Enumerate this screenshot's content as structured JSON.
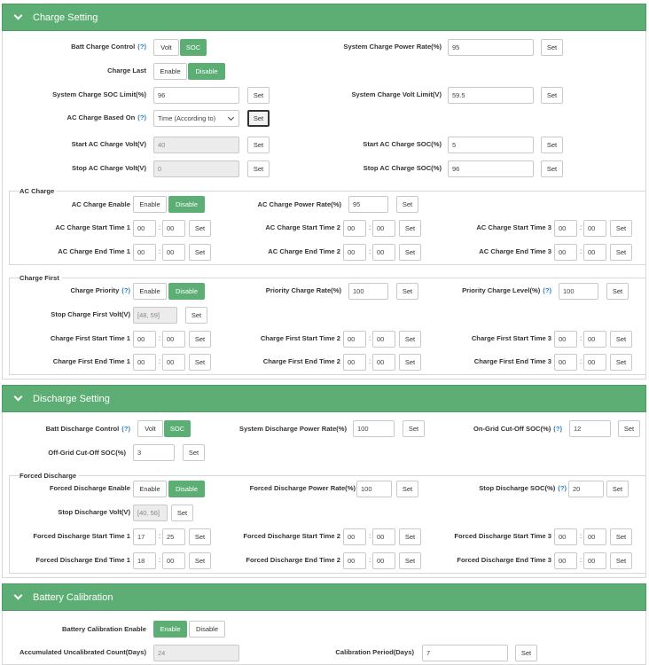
{
  "charge": {
    "title": "Charge Setting",
    "batt_charge_control": "Batt Charge Control",
    "volt": "Volt",
    "soc": "SOC",
    "sys_power_rate": "System Charge Power Rate(%)",
    "sys_power_rate_val": "95",
    "charge_last": "Charge Last",
    "enable": "Enable",
    "disable": "Disable",
    "sys_soc_limit": "System Charge SOC Limit(%)",
    "sys_soc_limit_val": "96",
    "sys_volt_limit": "System Charge Volt Limit(V)",
    "sys_volt_limit_val": "59.5",
    "ac_based_on": "AC Charge Based On",
    "ac_based_on_val": "Time (According to)",
    "start_ac_volt": "Start AC Charge Volt(V)",
    "start_ac_volt_val": "40",
    "start_ac_soc": "Start AC Charge SOC(%)",
    "start_ac_soc_val": "5",
    "stop_ac_volt": "Stop AC Charge Volt(V)",
    "stop_ac_volt_val": "0",
    "stop_ac_soc": "Stop AC Charge SOC(%)",
    "stop_ac_soc_val": "96",
    "set": "Set",
    "help": "(?)",
    "colon": ":"
  },
  "ac_charge": {
    "title": "AC Charge",
    "enable_label": "AC Charge Enable",
    "power_rate": "AC Charge Power Rate(%)",
    "power_rate_val": "95",
    "start1": "AC Charge Start Time 1",
    "start2": "AC Charge Start Time 2",
    "start3": "AC Charge Start Time 3",
    "end1": "AC Charge End Time 1",
    "end2": "AC Charge End Time 2",
    "end3": "AC Charge End Time 3",
    "zero": "00"
  },
  "charge_first": {
    "title": "Charge First",
    "priority": "Charge Priority",
    "priority_rate": "Priority Charge Rate(%)",
    "priority_rate_val": "100",
    "priority_level": "Priority Charge Level(%)",
    "priority_level_val": "100",
    "stop_volt": "Stop Charge First Volt(V)",
    "stop_volt_ph": "[48, 59]",
    "start1": "Charge First Start Time 1",
    "start2": "Charge First Start Time 2",
    "start3": "Charge First Start Time 3",
    "end1": "Charge First End Time 1",
    "end2": "Charge First End Time 2",
    "end3": "Charge First End Time 3"
  },
  "discharge": {
    "title": "Discharge Setting",
    "batt_control": "Batt Discharge Control",
    "sys_power_rate": "System Discharge Power Rate(%)",
    "sys_power_rate_val": "100",
    "on_grid_cutoff": "On-Grid Cut-Off SOC(%)",
    "on_grid_cutoff_val": "12",
    "off_grid_cutoff": "Off-Grid Cut-Off SOC(%)",
    "off_grid_cutoff_val": "3"
  },
  "forced": {
    "title": "Forced Discharge",
    "enable_label": "Forced Discharge Enable",
    "power_rate": "Forced Discharge Power Rate(%)",
    "power_rate_val": "100",
    "stop_soc": "Stop Discharge SOC(%)",
    "stop_soc_val": "20",
    "stop_volt": "Stop Discharge Volt(V)",
    "stop_volt_ph": "[40, 56]",
    "start1": "Forced Discharge Start Time 1",
    "start2": "Forced Discharge Start Time 2",
    "start3": "Forced Discharge Start Time 3",
    "end1": "Forced Discharge End Time 1",
    "end2": "Forced Discharge End Time 2",
    "end3": "Forced Discharge End Time 3",
    "start1_h": "17",
    "start1_m": "25",
    "end1_h": "18",
    "end1_m": "00"
  },
  "calib": {
    "title": "Battery Calibration",
    "enable_label": "Battery Calibration Enable",
    "count": "Accumulated Uncalibrated Count(Days)",
    "count_val": "24",
    "period": "Calibration Period(Days)",
    "period_val": "7"
  }
}
